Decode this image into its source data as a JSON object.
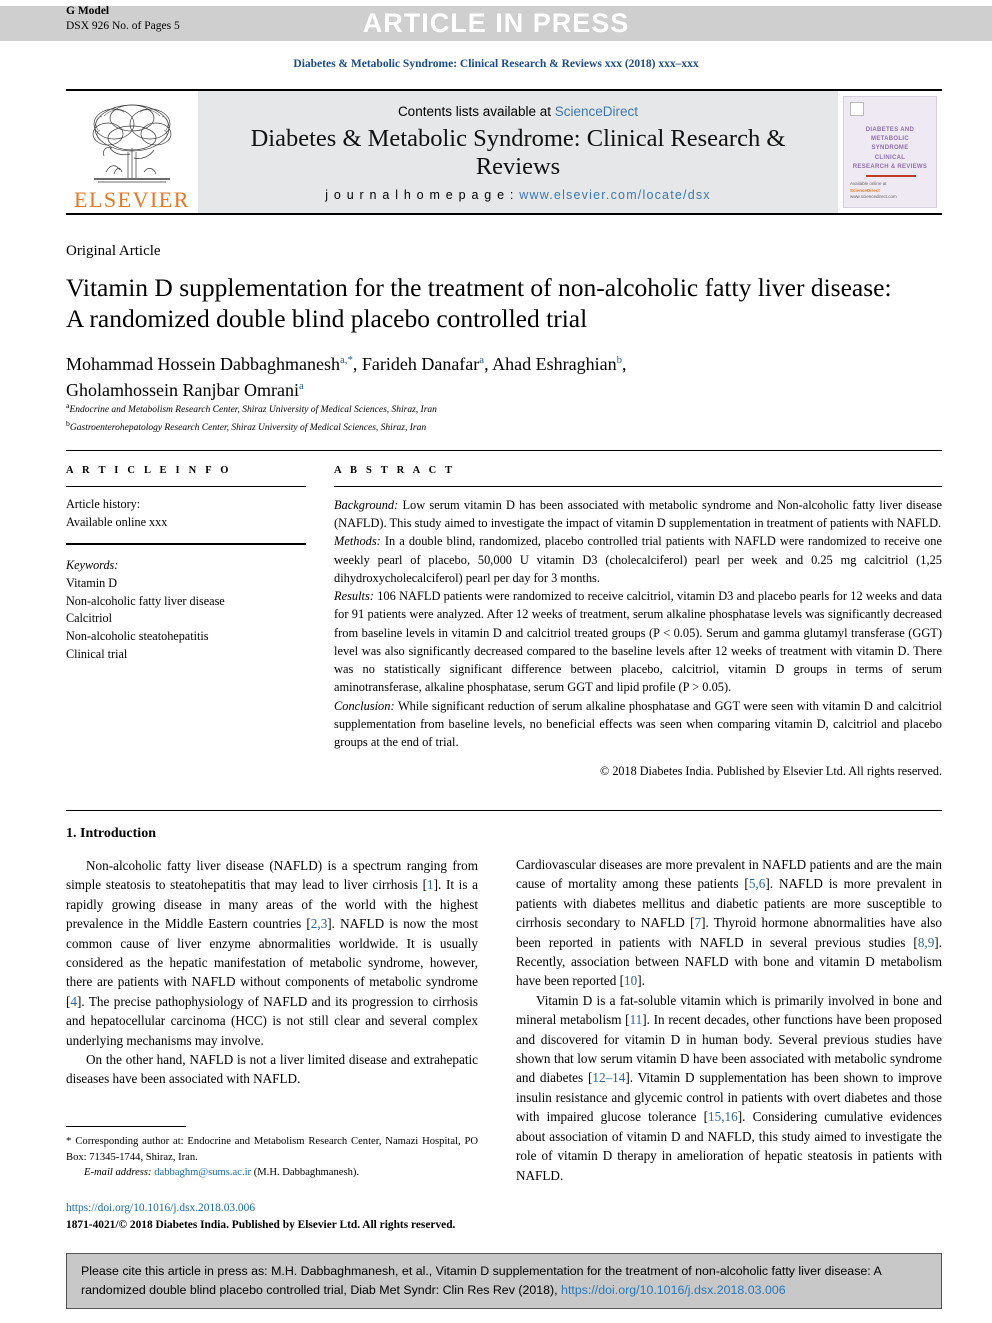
{
  "header": {
    "g_model_label": "G Model",
    "g_model_id": "DSX 926 No. of Pages 5",
    "banner": "ARTICLE IN PRESS",
    "journal_ref": "Diabetes & Metabolic Syndrome: Clinical Research & Reviews xxx (2018) xxx–xxx"
  },
  "masthead": {
    "publisher": "ELSEVIER",
    "contents_prefix": "Contents lists available at ",
    "contents_link": "ScienceDirect",
    "journal_title": "Diabetes & Metabolic Syndrome: Clinical Research & Reviews",
    "homepage_label": "j o u r n a l  h o m e p a g e :  ",
    "homepage_url": "www.elsevier.com/locate/dsx",
    "cover": {
      "line1": "DIABETES AND",
      "line2": "METABOLIC",
      "line3": "SYNDROME",
      "line4": "CLINICAL",
      "line5": "RESEARCH & REVIEWS",
      "footer_top": "Available online at",
      "footer_brand": "ScienceDirect",
      "footer_url": "www.sciencedirect.com"
    }
  },
  "article": {
    "type": "Original Article",
    "title": "Vitamin D supplementation for the treatment of non-alcoholic fatty liver disease: A randomized double blind placebo controlled trial",
    "authors_line1": "Mohammad Hossein Dabbaghmanesh",
    "authors_sup1": "a,*",
    "authors_line1b": ", Farideh Danafar",
    "authors_sup2": "a",
    "authors_line1c": ", Ahad Eshraghian",
    "authors_sup3": "b",
    "authors_line1d": ",",
    "authors_line2": "Gholamhossein Ranjbar Omrani",
    "authors_sup4": "a",
    "affiliation_a_marker": "a",
    "affiliation_a": "Endocrine and Metabolism Research Center, Shiraz University of Medical Sciences, Shiraz, Iran",
    "affiliation_b_marker": "b",
    "affiliation_b": "Gastroenterohepatology Research Center, Shiraz University of Medical Sciences, Shiraz, Iran"
  },
  "info": {
    "heading": "A R T I C L E   I N F O",
    "history_label": "Article history:",
    "history_value": "Available online xxx",
    "keywords_label": "Keywords:",
    "keywords": [
      "Vitamin D",
      "Non-alcoholic fatty liver disease",
      "Calcitriol",
      "Non-alcoholic steatohepatitis",
      "Clinical trial"
    ]
  },
  "abstract": {
    "heading": "A B S T R A C T",
    "background_label": "Background:",
    "background_text": " Low serum vitamin D has been associated with metabolic syndrome and Non-alcoholic fatty liver disease (NAFLD). This study aimed to investigate the impact of vitamin D supplementation in treatment of patients with NAFLD.",
    "methods_label": "Methods:",
    "methods_text": " In a double blind, randomized, placebo controlled trial patients with NAFLD were randomized to receive one weekly pearl of placebo, 50,000 U vitamin D3 (cholecalciferol) pearl per week and 0.25 mg calcitriol (1,25 dihydroxycholecalciferol) pearl per day for 3 months.",
    "results_label": "Results:",
    "results_text": " 106 NAFLD patients were randomized to receive calcitriol, vitamin D3 and placebo pearls for 12 weeks and data for 91 patients were analyzed. After 12 weeks of treatment, serum alkaline phosphatase levels was significantly decreased from baseline levels in vitamin D and calcitriol treated groups (P < 0.05). Serum and gamma glutamyl transferase (GGT) level was also significantly decreased compared to the baseline levels after 12 weeks of treatment with vitamin D. There was no statistically significant difference between placebo, calcitriol, vitamin D groups in terms of serum aminotransferase, alkaline phosphatase, serum GGT and lipid profile (P > 0.05).",
    "conclusion_label": "Conclusion:",
    "conclusion_text": " While significant reduction of serum alkaline phosphatase and GGT were seen with vitamin D and calcitriol supplementation from baseline levels, no beneficial effects was seen when comparing vitamin D, calcitriol and placebo groups at the end of trial.",
    "copyright": "© 2018 Diabetes India. Published by Elsevier Ltd. All rights reserved."
  },
  "introduction": {
    "heading": "1. Introduction",
    "left_p1_a": "Non-alcoholic fatty liver disease (NAFLD) is a spectrum ranging from simple steatosis to steatohepatitis that may lead to liver cirrhosis [",
    "left_p1_r1": "1",
    "left_p1_b": "]. It is a rapidly growing disease in many areas of the world with the highest prevalence in the Middle Eastern countries [",
    "left_p1_r2": "2,3",
    "left_p1_c": "]. NAFLD is now the most common cause of liver enzyme abnormalities worldwide. It is usually considered as the hepatic manifestation of metabolic syndrome, however, there are patients with NAFLD without components of metabolic syndrome [",
    "left_p1_r3": "4",
    "left_p1_d": "]. The precise pathophysiology of NAFLD and its progression to cirrhosis and hepatocellular carcinoma (HCC) is not still clear and several complex underlying mechanisms may involve.",
    "left_p2": "On the other hand, NAFLD is not a liver limited disease and extrahepatic diseases have been associated with NAFLD.",
    "right_p1_a": "Cardiovascular diseases are more prevalent in NAFLD patients and are the main cause of mortality among these patients [",
    "right_p1_r1": "5,6",
    "right_p1_b": "]. NAFLD is more prevalent in patients with diabetes mellitus and diabetic patients are more susceptible to cirrhosis secondary to NAFLD [",
    "right_p1_r2": "7",
    "right_p1_c": "]. Thyroid hormone abnormalities have also been reported in patients with NAFLD in several previous studies [",
    "right_p1_r3": "8,9",
    "right_p1_d": "]. Recently, association between NAFLD with bone and vitamin D metabolism have been reported [",
    "right_p1_r4": "10",
    "right_p1_e": "].",
    "right_p2_a": "Vitamin D is a fat-soluble vitamin which is primarily involved in bone and mineral metabolism [",
    "right_p2_r1": "11",
    "right_p2_b": "]. In recent decades, other functions have been proposed and discovered for vitamin D in human body. Several previous studies have shown that low serum vitamin D have been associated with metabolic syndrome and diabetes [",
    "right_p2_r2": "12–14",
    "right_p2_c": "]. Vitamin D supplementation has been shown to improve insulin resistance and glycemic control in patients with overt diabetes and those with impaired glucose tolerance [",
    "right_p2_r3": "15,16",
    "right_p2_d": "]. Considering cumulative evidences about association of vitamin D and NAFLD, this study aimed to investigate the role of vitamin D therapy in amelioration of hepatic steatosis in patients with NAFLD."
  },
  "footnotes": {
    "star": "*",
    "corresponding": " Corresponding author at: Endocrine and Metabolism Research Center, Namazi Hospital, PO Box: 71345-1744, Shiraz, Iran.",
    "email_label": "E-mail address:",
    "email": "dabbaghm@sums.ac.ir",
    "email_owner": " (M.H. Dabbaghmanesh).",
    "doi": "https://doi.org/10.1016/j.dsx.2018.03.006",
    "issn_line": "1871-4021/© 2018 Diabetes India. Published by Elsevier Ltd. All rights reserved."
  },
  "cite_box": {
    "text_a": "Please cite this article in press as: M.H. Dabbaghmanesh, et al., Vitamin D supplementation for the treatment of non-alcoholic fatty liver disease: A randomized double blind placebo controlled trial, Diab Met Syndr: Clin Res Rev (2018), ",
    "link": "https://doi.org/10.1016/j.dsx.2018.03.006"
  },
  "colors": {
    "banner_bg": "#cfcfcf",
    "link": "#1a6aa8",
    "journal_ref": "#1a4b8c",
    "elsevier_orange": "#e87722",
    "cite_box_bg": "#c8c8c8",
    "masthead_bg": "#e6e7e8",
    "reference_link": "#2a6496"
  }
}
